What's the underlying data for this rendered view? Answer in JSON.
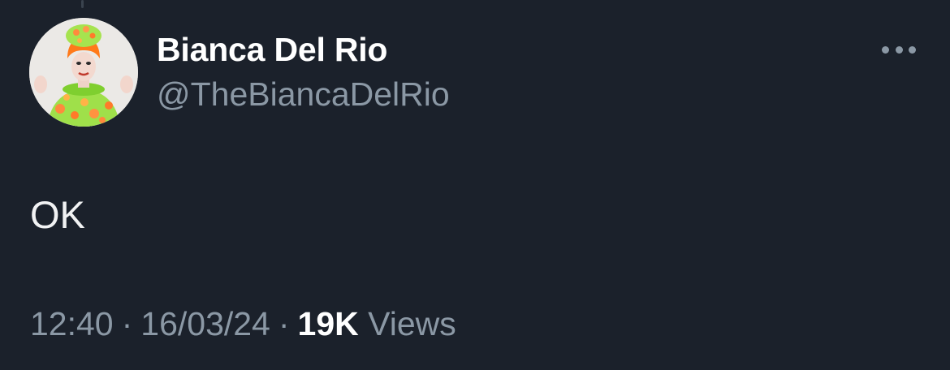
{
  "tweet": {
    "author": {
      "display_name": "Bianca Del Rio",
      "handle": "@TheBiancaDelRio",
      "avatar_icon": "profile-photo"
    },
    "text": "OK",
    "time": "12:40",
    "date": "16/03/24",
    "separator": "·",
    "views_count": "19K",
    "views_label": "Views",
    "more_icon": "more-horizontal-icon"
  },
  "colors": {
    "background": "#1b212b",
    "primary_text": "#ffffff",
    "secondary_text": "#8b98a5"
  }
}
